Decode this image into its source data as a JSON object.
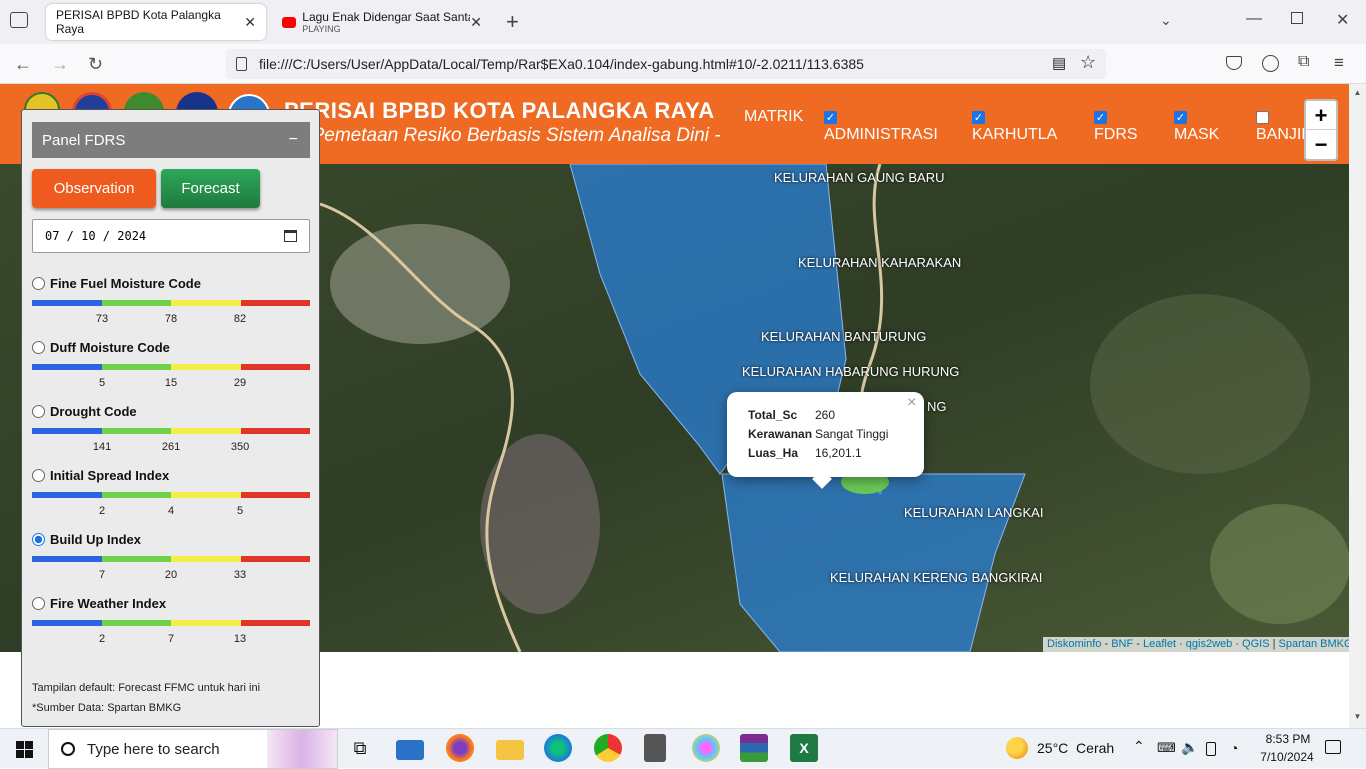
{
  "browser": {
    "tabs": [
      {
        "title": "PERISAI BPBD Kota Palangka Raya"
      },
      {
        "title": "Lagu Enak Didengar Saat Santai",
        "subtitle": "PLAYING"
      }
    ],
    "new_tab": "+",
    "url": "file:///C:/Users/User/AppData/Local/Temp/Rar$EXa0.104/index-gabung.html#10/-2.0211/113.6385"
  },
  "header": {
    "title": "PERISAI BPBD KOTA PALANGKA RAYA",
    "subtitle": "- Pemetaan Resiko Berbasis Sistem Analisa Dini -",
    "matrik": "MATRIK",
    "layers": [
      {
        "label": "ADMINISTRASI",
        "checked": true
      },
      {
        "label": "KARHUTLA",
        "checked": true
      },
      {
        "label": "FDRS",
        "checked": true
      },
      {
        "label": "MASK",
        "checked": true
      },
      {
        "label": "BANJIR",
        "checked": false
      }
    ]
  },
  "zoom": {
    "in": "+",
    "out": "−"
  },
  "panel": {
    "title": "Panel FDRS",
    "collapse": "−",
    "observation": "Observation",
    "forecast": "Forecast",
    "date": "07 / 10 / 2024",
    "indices": [
      {
        "name": "Fine Fuel Moisture Code",
        "selected": false,
        "ticks": [
          "73",
          "78",
          "82"
        ]
      },
      {
        "name": "Duff Moisture Code",
        "selected": false,
        "ticks": [
          "5",
          "15",
          "29"
        ]
      },
      {
        "name": "Drought Code",
        "selected": false,
        "ticks": [
          "141",
          "261",
          "350"
        ]
      },
      {
        "name": "Initial Spread Index",
        "selected": false,
        "ticks": [
          "2",
          "4",
          "5"
        ]
      },
      {
        "name": "Build Up Index",
        "selected": true,
        "ticks": [
          "7",
          "20",
          "33"
        ]
      },
      {
        "name": "Fire Weather Index",
        "selected": false,
        "ticks": [
          "2",
          "7",
          "13"
        ]
      }
    ],
    "note1": "Tampilan default: Forecast FFMC untuk hari ini",
    "note2": "*Sumber Data: Spartan BMKG",
    "colors": {
      "blue": "#2b64e3",
      "green": "#6fd24a",
      "yellow": "#f5ee4a",
      "red": "#e0362a"
    }
  },
  "map": {
    "labels": [
      "KELURAHAN GAUNG BARU",
      "KELURAHAN KAHARAKAN",
      "KELURAHAN BANTURUNG",
      "KELURAHAN HABARUNG HURUNG",
      "KELURAHAN LANGKAI",
      "KELURAHAN KERENG BANGKIRAI",
      "NG"
    ],
    "popup": {
      "rows": [
        {
          "key": "Total_Sc",
          "value": "260"
        },
        {
          "key": "Kerawanan",
          "value": "Sangat Tinggi"
        },
        {
          "key": "Luas_Ha",
          "value": "16,201.1"
        }
      ],
      "close": "×"
    },
    "attribution": {
      "a": "Diskominfo",
      "b": "BNF",
      "c": "Leaflet",
      "d": "qgis2web",
      "e": "QGIS",
      "f": "Spartan BMKG",
      "sep1": " - ",
      "sep2": " · ",
      "sep3": " | "
    }
  },
  "taskbar": {
    "search": "Type here to search",
    "weather": "25°C  Cerah",
    "time": "8:53 PM",
    "date": "7/10/2024"
  }
}
